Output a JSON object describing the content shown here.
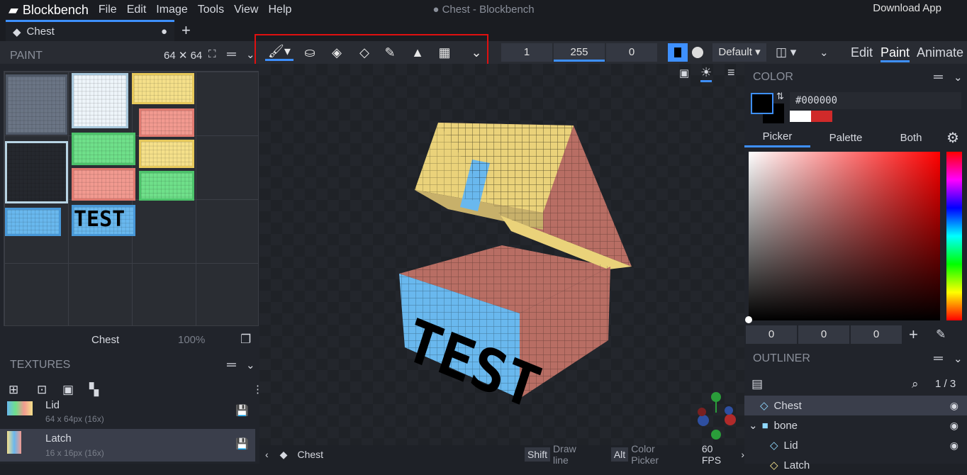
{
  "app": {
    "name": "Blockbench",
    "window_title": "● Chest - Blockbench",
    "download": "Download App"
  },
  "menu": [
    "File",
    "Edit",
    "Image",
    "Tools",
    "View",
    "Help"
  ],
  "tabs": [
    {
      "label": "Chest",
      "modified": "●"
    }
  ],
  "toolbar": {
    "brush_size": "1",
    "opacity": "255",
    "softness": "0",
    "blend": "Default",
    "modes": [
      "Edit",
      "Paint",
      "Animate"
    ],
    "active_mode": "Paint"
  },
  "paint": {
    "title": "PAINT",
    "size": "64 ✕ 64",
    "texture_name": "Chest",
    "zoom": "100%",
    "atlas_text": "TEST"
  },
  "textures": {
    "title": "TEXTURES",
    "items": [
      {
        "name": "Lid",
        "info": "64 x 64px (16x)"
      },
      {
        "name": "Latch",
        "info": "16 x 16px (16x)"
      }
    ]
  },
  "color": {
    "title": "COLOR",
    "hex": "#000000",
    "tabs": [
      "Picker",
      "Palette",
      "Both"
    ],
    "rgb": [
      "0",
      "0",
      "0"
    ],
    "primary": "#000000",
    "palette": [
      "#ffffff",
      "#d02a2a"
    ]
  },
  "outliner": {
    "title": "OUTLINER",
    "count": "1 / 3",
    "items": [
      {
        "name": "Chest",
        "type": "mesh",
        "selected": true
      },
      {
        "name": "bone",
        "type": "group"
      },
      {
        "name": "Lid",
        "type": "mesh"
      },
      {
        "name": "Latch",
        "type": "mesh"
      }
    ]
  },
  "status": {
    "model": "Chest",
    "hints": [
      {
        "key": "Shift",
        "action": "Draw line"
      },
      {
        "key": "Alt",
        "action": "Color Picker"
      }
    ],
    "fps": "60 FPS"
  },
  "viewport": {
    "model_text": "TEST"
  }
}
